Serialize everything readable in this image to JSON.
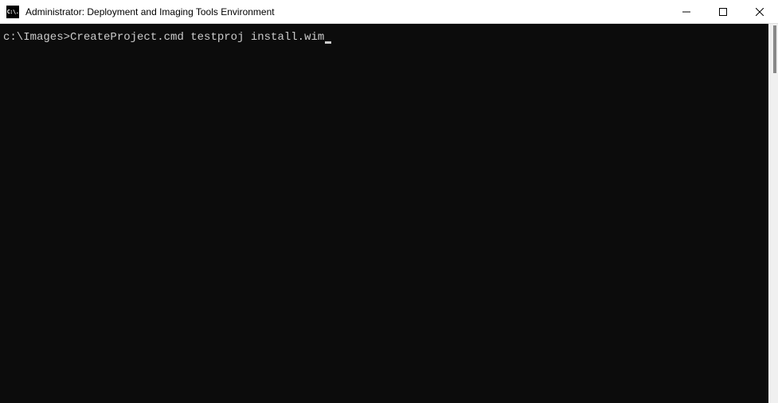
{
  "titlebar": {
    "title": "Administrator: Deployment and Imaging Tools Environment",
    "icon_text": "C:\\."
  },
  "terminal": {
    "prompt": "c:\\Images>",
    "command": "CreateProject.cmd testproj install.wim"
  }
}
